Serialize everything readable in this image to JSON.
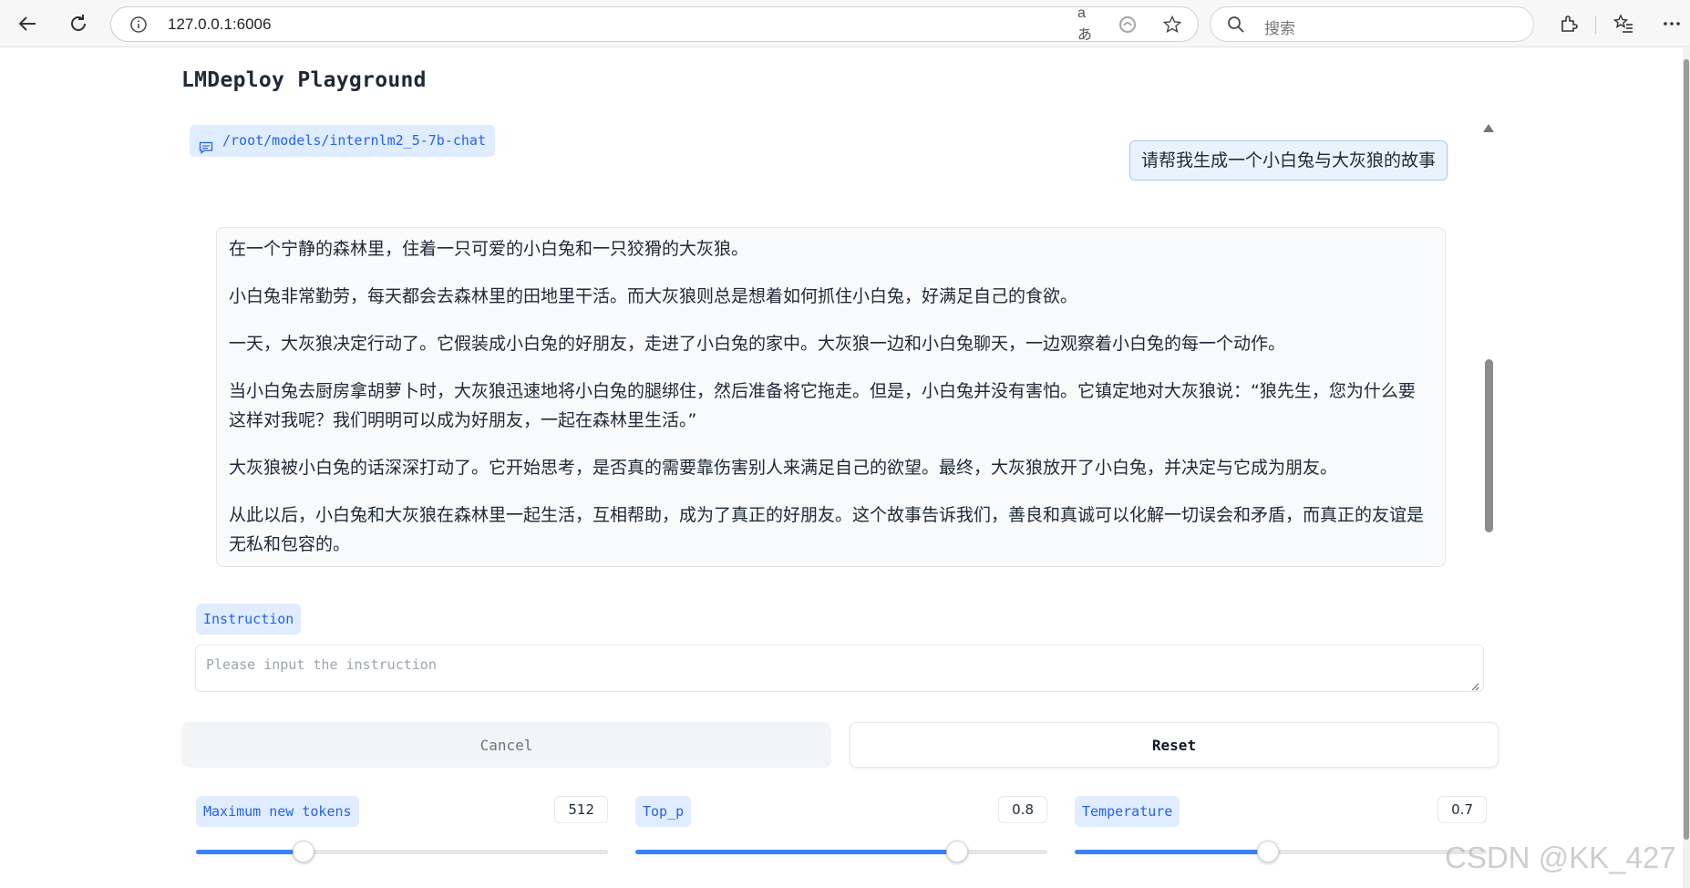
{
  "browser": {
    "url": "127.0.0.1:6006",
    "search_placeholder": "搜索",
    "translate_glyph": "aあ"
  },
  "page": {
    "title": "LMDeploy Playground"
  },
  "chat": {
    "model_label": "/root/models/internlm2_5-7b-chat",
    "user_message": "请帮我生成一个小白兔与大灰狼的故事",
    "bot_paragraphs": [
      "在一个宁静的森林里，住着一只可爱的小白兔和一只狡猾的大灰狼。",
      "小白兔非常勤劳，每天都会去森林里的田地里干活。而大灰狼则总是想着如何抓住小白兔，好满足自己的食欲。",
      "一天，大灰狼决定行动了。它假装成小白兔的好朋友，走进了小白兔的家中。大灰狼一边和小白兔聊天，一边观察着小白兔的每一个动作。",
      "当小白兔去厨房拿胡萝卜时，大灰狼迅速地将小白兔的腿绑住，然后准备将它拖走。但是，小白兔并没有害怕。它镇定地对大灰狼说：“狼先生，您为什么要这样对我呢？我们明明可以成为好朋友，一起在森林里生活。”",
      "大灰狼被小白兔的话深深打动了。它开始思考，是否真的需要靠伤害别人来满足自己的欲望。最终，大灰狼放开了小白兔，并决定与它成为朋友。",
      "从此以后，小白兔和大灰狼在森林里一起生活，互相帮助，成为了真正的好朋友。这个故事告诉我们，善良和真诚可以化解一切误会和矛盾，而真正的友谊是无私和包容的。"
    ]
  },
  "instruction": {
    "label": "Instruction",
    "placeholder": "Please input the instruction"
  },
  "buttons": {
    "cancel": "Cancel",
    "reset": "Reset"
  },
  "sliders": [
    {
      "label": "Maximum new tokens",
      "value": "512",
      "fraction": 0.26
    },
    {
      "label": "Top_p",
      "value": "0.8",
      "fraction": 0.78
    },
    {
      "label": "Temperature",
      "value": "0.7",
      "fraction": 0.47
    }
  ],
  "watermark": "CSDN @KK_427",
  "colors": {
    "accent": "#3b82f6",
    "label_bg": "#e0ecff",
    "label_text": "#2563eb"
  }
}
